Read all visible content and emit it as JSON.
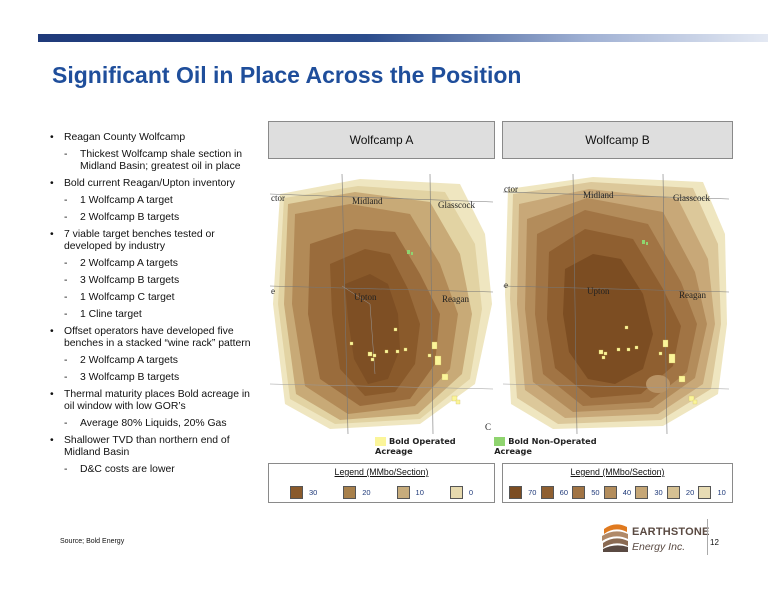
{
  "slide": {
    "title": "Significant Oil in Place Across the Position",
    "source": "Source;  Bold Energy",
    "page_number": "12",
    "colors": {
      "title_blue": "#1f4e9b",
      "bar_dark": "#1f3a7a",
      "bar_light": "#dfe6f2"
    }
  },
  "bullets": [
    {
      "level": 1,
      "text": "Reagan County Wolfcamp"
    },
    {
      "level": 2,
      "text": "Thickest Wolfcamp shale section in Midland Basin; greatest oil in place"
    },
    {
      "level": 1,
      "text": "Bold current Reagan/Upton inventory"
    },
    {
      "level": 2,
      "text": "1 Wolfcamp A target"
    },
    {
      "level": 2,
      "text": "2 Wolfcamp B targets"
    },
    {
      "level": 1,
      "text": "7 viable target benches tested or developed by industry"
    },
    {
      "level": 2,
      "text": "2 Wolfcamp A targets"
    },
    {
      "level": 2,
      "text": "3 Wolfcamp B targets"
    },
    {
      "level": 2,
      "text": "1 Wolfcamp C target"
    },
    {
      "level": 2,
      "text": "1 Cline target"
    },
    {
      "level": 1,
      "text": "Offset operators have developed five benches in a stacked “wine rack” pattern"
    },
    {
      "level": 2,
      "text": "2 Wolfcamp A targets"
    },
    {
      "level": 2,
      "text": "3 Wolfcamp B targets"
    },
    {
      "level": 1,
      "text": "Thermal maturity places Bold acreage in oil window with low GOR’s"
    },
    {
      "level": 2,
      "text": "Average 80% Liquids, 20% Gas"
    },
    {
      "level": 1,
      "text": "Shallower TVD than northern end of Midland Basin"
    },
    {
      "level": 2,
      "text": "D&C costs are lower"
    }
  ],
  "maps": {
    "left": {
      "title": "Wolfcamp A",
      "labels": {
        "midland": "Midland",
        "glasscock": "Glasscock",
        "upton": "Upton",
        "reagan": "Reagan",
        "edge_top": "ctor",
        "edge_mid": "e",
        "edge_bottom": "C"
      }
    },
    "right": {
      "title": "Wolfcamp B",
      "labels": {
        "midland": "Midland",
        "glasscock": "Glasscock",
        "upton": "Upton",
        "reagan": "Reagan",
        "edge_top": "ctor",
        "edge_mid": "e"
      }
    }
  },
  "acreage_legend": {
    "operated_label": "Bold Operated Acreage",
    "operated_color": "#fbf59a",
    "non_operated_label": "Bold Non-Operated Acreage",
    "non_operated_color": "#8fd46f"
  },
  "legend_a": {
    "title": "Legend (MMbo/Section)",
    "items": [
      {
        "value": "30",
        "color": "#8a5a2b"
      },
      {
        "value": "20",
        "color": "#a8804b"
      },
      {
        "value": "10",
        "color": "#c7ac7c"
      },
      {
        "value": "0",
        "color": "#e6d9ae"
      }
    ]
  },
  "legend_b": {
    "title": "Legend (MMbo/Section)",
    "items": [
      {
        "value": "70",
        "color": "#7c4d22"
      },
      {
        "value": "60",
        "color": "#8f5f30"
      },
      {
        "value": "50",
        "color": "#a17444"
      },
      {
        "value": "40",
        "color": "#b38d5c"
      },
      {
        "value": "30",
        "color": "#c5a676"
      },
      {
        "value": "20",
        "color": "#d6c193"
      },
      {
        "value": "10",
        "color": "#e8dcb4"
      }
    ]
  },
  "logo": {
    "line1": "EARTHSTONE",
    "line2": "Energy Inc.",
    "icon": "earthstone-logo-icon"
  }
}
